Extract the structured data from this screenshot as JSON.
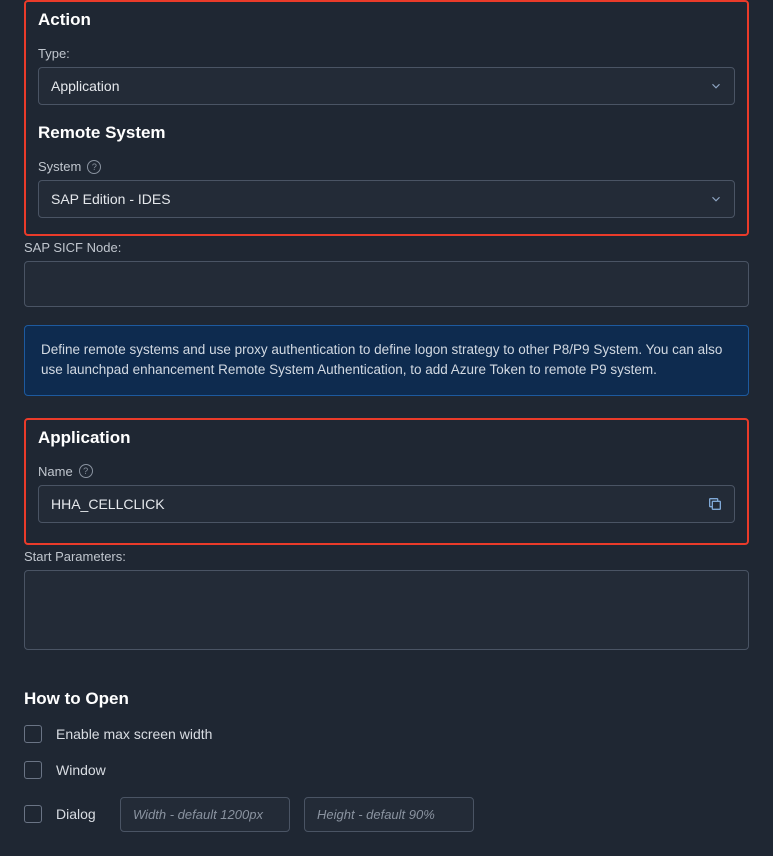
{
  "action": {
    "header": "Action",
    "type_label": "Type:",
    "type_value": "Application"
  },
  "remote_system": {
    "header": "Remote System",
    "system_label": "System",
    "system_value": "SAP Edition - IDES"
  },
  "sap_sicf": {
    "label": "SAP SICF Node:",
    "value": ""
  },
  "info_banner": "Define remote systems and use proxy authentication to define logon strategy to other P8/P9 System. You can also use launchpad enhancement Remote System Authentication, to add Azure Token to remote P9 system.",
  "application": {
    "header": "Application",
    "name_label": "Name",
    "name_value": "HHA_CELLCLICK"
  },
  "start_parameters": {
    "label": "Start Parameters:",
    "value": ""
  },
  "how_to_open": {
    "header": "How to Open",
    "enable_max_label": "Enable max screen width",
    "window_label": "Window",
    "dialog_label": "Dialog",
    "width_placeholder": "Width - default 1200px",
    "height_placeholder": "Height - default 90%"
  }
}
